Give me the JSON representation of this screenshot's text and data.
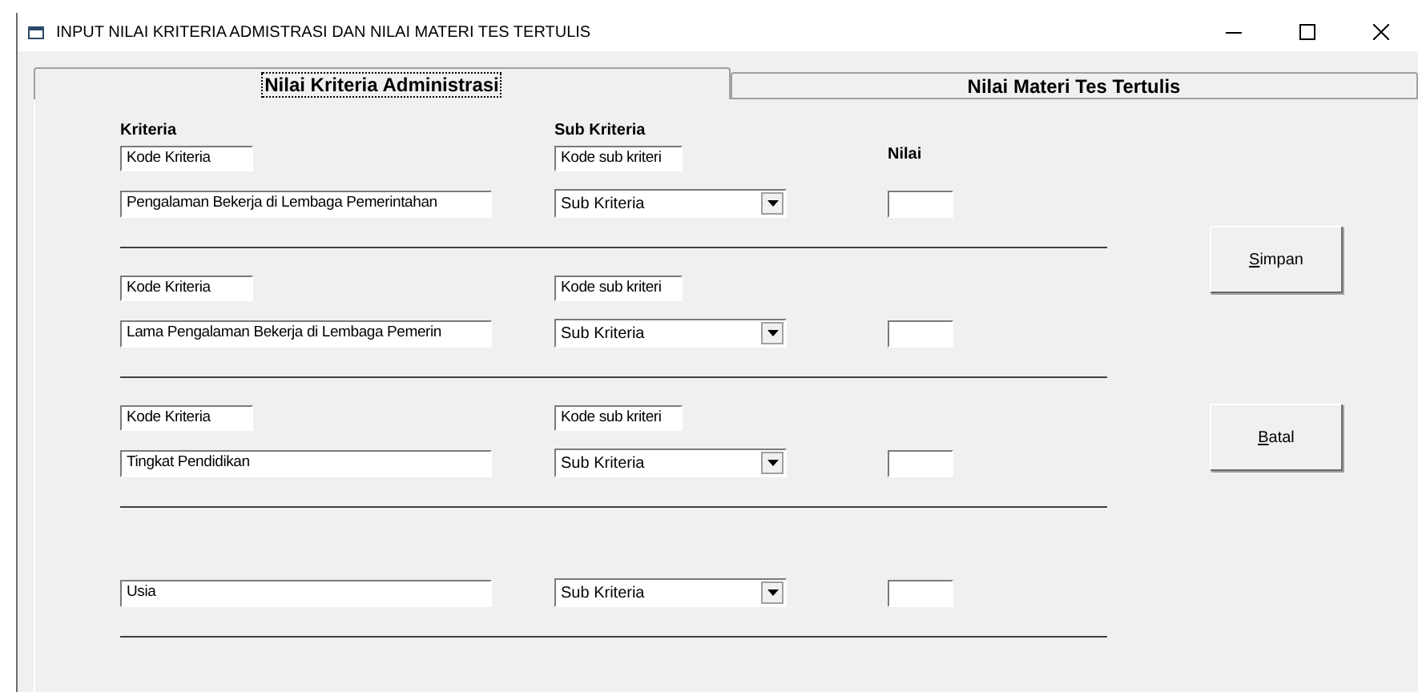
{
  "window": {
    "title": "INPUT NILAI KRITERIA ADMISTRASI DAN NILAI MATERI TES TERTULIS"
  },
  "tabs": [
    {
      "label": "Nilai Kriteria Administrasi",
      "selected": true
    },
    {
      "label": "Nilai Materi Tes Tertulis",
      "selected": false
    }
  ],
  "headers": {
    "kriteria": "Kriteria",
    "sub_kriteria": "Sub Kriteria",
    "nilai": "Nilai"
  },
  "groups": [
    {
      "kode_kriteria": "Kode Kriteria",
      "kode_sub_kriteria": "Kode sub kriteri",
      "kriteria": "Pengalaman Bekerja di Lembaga Pemerintahan",
      "sub_kriteria": "Sub Kriteria"
    },
    {
      "kode_kriteria": "Kode Kriteria",
      "kode_sub_kriteria": "Kode sub kriteri",
      "kriteria": "Lama Pengalaman Bekerja di Lembaga Pemerin",
      "sub_kriteria": "Sub Kriteria"
    },
    {
      "kode_kriteria": "Kode Kriteria",
      "kode_sub_kriteria": "Kode sub kriteri",
      "kriteria": "Tingkat Pendidikan",
      "sub_kriteria": "Sub Kriteria"
    },
    {
      "kriteria": "Usia",
      "sub_kriteria": "Sub Kriteria"
    }
  ],
  "buttons": [
    "Simpan",
    "Batal"
  ]
}
